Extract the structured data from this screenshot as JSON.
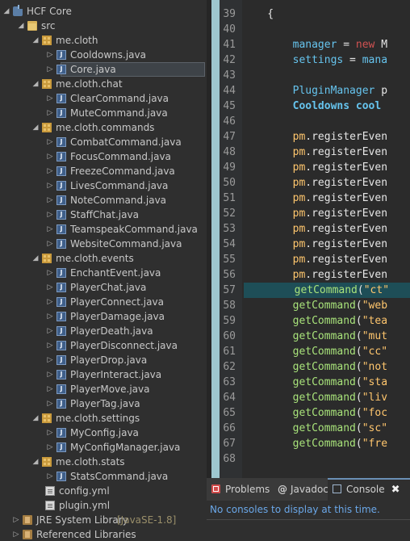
{
  "explorer": {
    "rows": [
      {
        "label": "HCF Core",
        "icon": "project-icon",
        "expanded": true
      },
      {
        "label": "src",
        "icon": "source-folder-icon",
        "expanded": true
      },
      {
        "label": "me.cloth",
        "icon": "package-icon",
        "expanded": true
      },
      {
        "label": "Cooldowns.java",
        "icon": "java-file-icon",
        "expanded": false
      },
      {
        "label": "Core.java",
        "icon": "java-file-icon",
        "expanded": false,
        "selected": true
      },
      {
        "label": "me.cloth.chat",
        "icon": "package-icon",
        "expanded": true
      },
      {
        "label": "ClearCommand.java",
        "icon": "java-file-icon",
        "expanded": false
      },
      {
        "label": "MuteCommand.java",
        "icon": "java-file-icon",
        "expanded": false
      },
      {
        "label": "me.cloth.commands",
        "icon": "package-icon",
        "expanded": true
      },
      {
        "label": "CombatCommand.java",
        "icon": "java-file-icon",
        "expanded": false
      },
      {
        "label": "FocusCommand.java",
        "icon": "java-file-icon",
        "expanded": false
      },
      {
        "label": "FreezeCommand.java",
        "icon": "java-file-icon",
        "expanded": false
      },
      {
        "label": "LivesCommand.java",
        "icon": "java-file-icon",
        "expanded": false
      },
      {
        "label": "NoteCommand.java",
        "icon": "java-file-icon",
        "expanded": false
      },
      {
        "label": "StaffChat.java",
        "icon": "java-file-icon",
        "expanded": false
      },
      {
        "label": "TeamspeakCommand.java",
        "icon": "java-file-icon",
        "expanded": false
      },
      {
        "label": "WebsiteCommand.java",
        "icon": "java-file-icon",
        "expanded": false
      },
      {
        "label": "me.cloth.events",
        "icon": "package-icon",
        "expanded": true
      },
      {
        "label": "EnchantEvent.java",
        "icon": "java-file-icon",
        "expanded": false
      },
      {
        "label": "PlayerChat.java",
        "icon": "java-file-icon",
        "expanded": false
      },
      {
        "label": "PlayerConnect.java",
        "icon": "java-file-icon",
        "expanded": false
      },
      {
        "label": "PlayerDamage.java",
        "icon": "java-file-icon",
        "expanded": false
      },
      {
        "label": "PlayerDeath.java",
        "icon": "java-file-icon",
        "expanded": false
      },
      {
        "label": "PlayerDisconnect.java",
        "icon": "java-file-icon",
        "expanded": false
      },
      {
        "label": "PlayerDrop.java",
        "icon": "java-file-icon",
        "expanded": false
      },
      {
        "label": "PlayerInteract.java",
        "icon": "java-file-icon",
        "expanded": false
      },
      {
        "label": "PlayerMove.java",
        "icon": "java-file-icon",
        "expanded": false
      },
      {
        "label": "PlayerTag.java",
        "icon": "java-file-icon",
        "expanded": false
      },
      {
        "label": "me.cloth.settings",
        "icon": "package-icon",
        "expanded": true
      },
      {
        "label": "MyConfig.java",
        "icon": "java-file-icon",
        "expanded": false
      },
      {
        "label": "MyConfigManager.java",
        "icon": "java-file-icon",
        "expanded": false
      },
      {
        "label": "me.cloth.stats",
        "icon": "package-icon",
        "expanded": true
      },
      {
        "label": "StatsCommand.java",
        "icon": "java-file-icon",
        "expanded": false
      },
      {
        "label": "config.yml",
        "icon": "yml-file-icon",
        "leaf": true
      },
      {
        "label": "plugin.yml",
        "icon": "yml-file-icon",
        "leaf": true
      },
      {
        "label": "JRE System Library",
        "suffix": "[JavaSE-1.8]",
        "icon": "library-icon",
        "expanded": false
      },
      {
        "label": "Referenced Libraries",
        "icon": "library-icon",
        "expanded": false
      }
    ]
  },
  "editor": {
    "lines": [
      {
        "n": "39",
        "segs": [
          {
            "t": "    {",
            "c": "plain"
          }
        ]
      },
      {
        "n": "40",
        "segs": []
      },
      {
        "n": "41",
        "segs": [
          {
            "t": "        manager",
            "c": "fld"
          },
          {
            "t": " = ",
            "c": "plain"
          },
          {
            "t": "new",
            "c": "kw"
          },
          {
            "t": " M",
            "c": "plain"
          }
        ]
      },
      {
        "n": "42",
        "segs": [
          {
            "t": "        settings",
            "c": "fld"
          },
          {
            "t": " = ",
            "c": "plain"
          },
          {
            "t": "mana",
            "c": "fld"
          }
        ]
      },
      {
        "n": "43",
        "segs": []
      },
      {
        "n": "44",
        "segs": [
          {
            "t": "        PluginManager",
            "c": "fld"
          },
          {
            "t": " p",
            "c": "plain"
          }
        ]
      },
      {
        "n": "45",
        "segs": [
          {
            "t": "        Cooldowns cool",
            "c": "typ"
          }
        ]
      },
      {
        "n": "46",
        "segs": []
      },
      {
        "n": "47",
        "segs": [
          {
            "t": "        pm",
            "c": "str"
          },
          {
            "t": ".registerEven",
            "c": "plain"
          }
        ]
      },
      {
        "n": "48",
        "segs": [
          {
            "t": "        pm",
            "c": "str"
          },
          {
            "t": ".registerEven",
            "c": "plain"
          }
        ]
      },
      {
        "n": "49",
        "segs": [
          {
            "t": "        pm",
            "c": "str"
          },
          {
            "t": ".registerEven",
            "c": "plain"
          }
        ]
      },
      {
        "n": "50",
        "segs": [
          {
            "t": "        pm",
            "c": "str"
          },
          {
            "t": ".registerEven",
            "c": "plain"
          }
        ]
      },
      {
        "n": "51",
        "segs": [
          {
            "t": "        pm",
            "c": "str"
          },
          {
            "t": ".registerEven",
            "c": "plain"
          }
        ]
      },
      {
        "n": "52",
        "segs": [
          {
            "t": "        pm",
            "c": "str"
          },
          {
            "t": ".registerEven",
            "c": "plain"
          }
        ]
      },
      {
        "n": "53",
        "segs": [
          {
            "t": "        pm",
            "c": "str"
          },
          {
            "t": ".registerEven",
            "c": "plain"
          }
        ]
      },
      {
        "n": "54",
        "segs": [
          {
            "t": "        pm",
            "c": "str"
          },
          {
            "t": ".registerEven",
            "c": "plain"
          }
        ]
      },
      {
        "n": "55",
        "segs": [
          {
            "t": "        pm",
            "c": "str"
          },
          {
            "t": ".registerEven",
            "c": "plain"
          }
        ]
      },
      {
        "n": "56",
        "segs": [
          {
            "t": "        pm",
            "c": "str"
          },
          {
            "t": ".registerEven",
            "c": "plain"
          }
        ]
      },
      {
        "n": "57",
        "segs": [
          {
            "t": "        getCommand",
            "c": "meth"
          },
          {
            "t": "(",
            "c": "plain"
          },
          {
            "t": "\"ct\"",
            "c": "str"
          }
        ],
        "highlight": true
      },
      {
        "n": "58",
        "segs": [
          {
            "t": "        getCommand",
            "c": "meth"
          },
          {
            "t": "(",
            "c": "plain"
          },
          {
            "t": "\"web",
            "c": "str"
          }
        ]
      },
      {
        "n": "59",
        "segs": [
          {
            "t": "        getCommand",
            "c": "meth"
          },
          {
            "t": "(",
            "c": "plain"
          },
          {
            "t": "\"tea",
            "c": "str"
          }
        ]
      },
      {
        "n": "60",
        "segs": [
          {
            "t": "        getCommand",
            "c": "meth"
          },
          {
            "t": "(",
            "c": "plain"
          },
          {
            "t": "\"mut",
            "c": "str"
          }
        ]
      },
      {
        "n": "61",
        "segs": [
          {
            "t": "        getCommand",
            "c": "meth"
          },
          {
            "t": "(",
            "c": "plain"
          },
          {
            "t": "\"cc\"",
            "c": "str"
          }
        ]
      },
      {
        "n": "62",
        "segs": [
          {
            "t": "        getCommand",
            "c": "meth"
          },
          {
            "t": "(",
            "c": "plain"
          },
          {
            "t": "\"not",
            "c": "str"
          }
        ]
      },
      {
        "n": "63",
        "segs": [
          {
            "t": "        getCommand",
            "c": "meth"
          },
          {
            "t": "(",
            "c": "plain"
          },
          {
            "t": "\"sta",
            "c": "str"
          }
        ]
      },
      {
        "n": "64",
        "segs": [
          {
            "t": "        getCommand",
            "c": "meth"
          },
          {
            "t": "(",
            "c": "plain"
          },
          {
            "t": "\"liv",
            "c": "str"
          }
        ]
      },
      {
        "n": "65",
        "segs": [
          {
            "t": "        getCommand",
            "c": "meth"
          },
          {
            "t": "(",
            "c": "plain"
          },
          {
            "t": "\"foc",
            "c": "str"
          }
        ]
      },
      {
        "n": "66",
        "segs": [
          {
            "t": "        getCommand",
            "c": "meth"
          },
          {
            "t": "(",
            "c": "plain"
          },
          {
            "t": "\"sc\"",
            "c": "str"
          }
        ]
      },
      {
        "n": "67",
        "segs": [
          {
            "t": "        getCommand",
            "c": "meth"
          },
          {
            "t": "(",
            "c": "plain"
          },
          {
            "t": "\"fre",
            "c": "str"
          }
        ]
      },
      {
        "n": "68",
        "segs": []
      }
    ]
  },
  "console": {
    "tabs": {
      "problems": "Problems",
      "javadoc": "Javadoc",
      "console": "Console",
      "javadoc_glyph": "@",
      "close_glyph": "✖"
    },
    "message": "No consoles to display at this time."
  },
  "colors": {
    "highlight_line": "#1e4e57",
    "keyword": "#d25252",
    "field": "#66c4ee",
    "string": "#ffc66d",
    "method": "#a8e27a",
    "console_text": "#6aa7e8"
  }
}
